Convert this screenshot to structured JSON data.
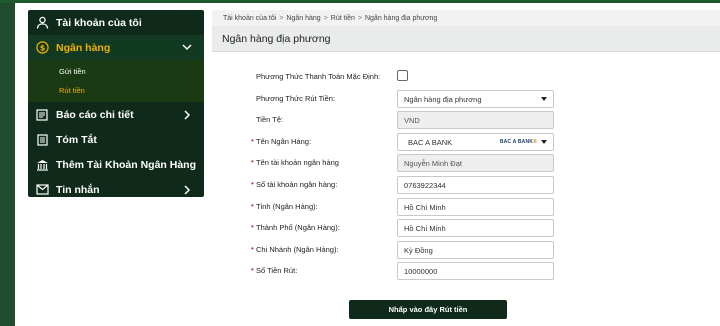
{
  "sidebar": {
    "items": [
      {
        "label": "Tài khoản của tôi",
        "icon": "user-icon"
      },
      {
        "label": "Ngân hàng",
        "icon": "dollar-circle-icon",
        "active": true,
        "sub": [
          "Gửi tiền",
          "Rút tiền"
        ],
        "current_sub": "Rút tiền"
      },
      {
        "label": "Báo cáo chi tiết",
        "icon": "report-icon"
      },
      {
        "label": "Tóm Tắt",
        "icon": "summary-icon"
      },
      {
        "label": "Thêm Tài Khoản Ngân Hàng",
        "icon": "bank-building-icon"
      },
      {
        "label": "Tin nhắn",
        "icon": "envelope-icon"
      }
    ]
  },
  "breadcrumb": [
    "Tài khoản của tôi",
    "Ngân hàng",
    "Rút tiền",
    "Ngân hàng địa phương"
  ],
  "breadcrumb_sep": ">",
  "page_title": "Ngân hàng địa phương",
  "form": {
    "default_payment_label": "Phương Thức Thanh Toán Mặc Định:",
    "withdraw_method_label": "Phương Thức Rút Tiền:",
    "withdraw_method_value": "Ngân hàng địa phương",
    "currency_label": "Tiền Tệ:",
    "currency_value": "VND",
    "bank_name_label": "Tên Ngân Hàng:",
    "bank_name_value": "BAC A BANK",
    "bank_logo_text": "BAC A BANK",
    "account_name_label": "Tên tài khoản ngân hàng",
    "account_name_value": "Nguyễn Minh Đạt",
    "account_number_label": "Số tài khoản ngân hàng:",
    "account_number_value": "0763922344",
    "province_label": "Tỉnh (Ngân Hàng):",
    "province_value": "Hồ Chí Minh",
    "city_label": "Thành Phố (Ngân Hàng):",
    "city_value": "Hồ Chí Minh",
    "branch_label": "Chi Nhánh (Ngân Hàng):",
    "branch_value": "Kỳ Đồng",
    "amount_label": "Số Tiền Rút:",
    "amount_value": "10000000"
  },
  "submit_label": "Nhấp vào đây Rút tiền",
  "colors": {
    "accent": "#0f2a1b",
    "active": "#f0b000",
    "required": "#c0392b"
  }
}
